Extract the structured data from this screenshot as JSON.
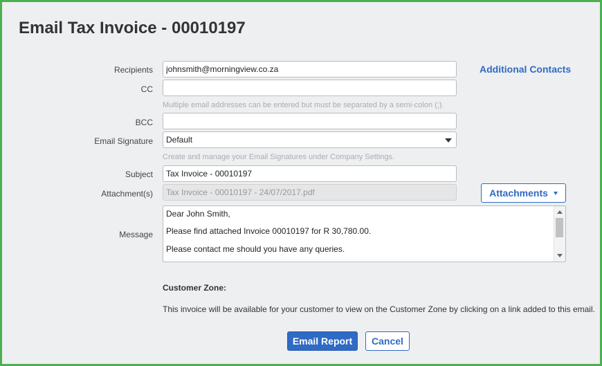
{
  "dialog": {
    "title": "Email Tax Invoice - 00010197"
  },
  "form": {
    "recipients_label": "Recipients",
    "recipients_value": "johnsmith@morningview.co.za",
    "additional_contacts_link": "Additional Contacts",
    "cc_label": "CC",
    "cc_value": "",
    "cc_hint": "Multiple email addresses can be entered but must be separated by a semi-colon (;).",
    "bcc_label": "BCC",
    "bcc_value": "",
    "signature_label": "Email Signature",
    "signature_value": "Default",
    "signature_hint": "Create and manage your Email Signatures under Company Settings.",
    "subject_label": "Subject",
    "subject_value": "Tax Invoice - 00010197",
    "attachments_label": "Attachment(s)",
    "attachments_value": "Tax Invoice - 00010197 - 24/07/2017.pdf",
    "attachments_button": "Attachments",
    "message_label": "Message",
    "message_lines": [
      "Dear John Smith,",
      "Please find attached Invoice 00010197 for R 30,780.00.",
      "Please contact me should you have any queries."
    ]
  },
  "customer_zone": {
    "title": "Customer Zone:",
    "text": "This invoice will be available for your customer to view on the Customer Zone by clicking on a link added to this email."
  },
  "actions": {
    "email_report": "Email Report",
    "cancel": "Cancel"
  },
  "colors": {
    "frame_border": "#4caf50",
    "accent": "#2f6ac4",
    "background": "#eeeff1"
  },
  "icons": {
    "select_arrow": "chevron-down-icon",
    "attachments_caret": "caret-down-icon"
  }
}
